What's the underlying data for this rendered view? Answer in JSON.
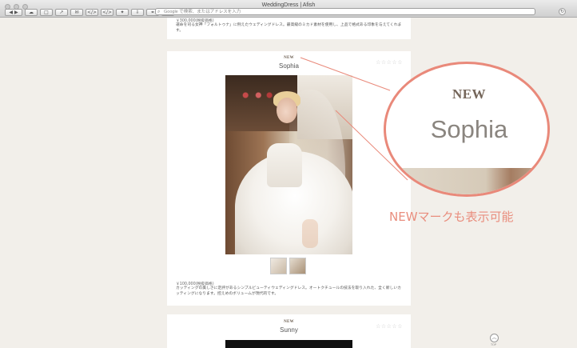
{
  "window": {
    "title": "WeddingDress | Afish"
  },
  "toolbar": {
    "buttons": [
      {
        "name": "back-forward-button",
        "glyph": "◀ ▶"
      },
      {
        "name": "sidebar-button",
        "glyph": "☁"
      },
      {
        "name": "bookmarks-button",
        "glyph": "□"
      },
      {
        "name": "share-button",
        "glyph": "↗"
      },
      {
        "name": "mail-button",
        "glyph": "✉"
      },
      {
        "name": "code-button",
        "glyph": "</>"
      },
      {
        "name": "code-button-2",
        "glyph": "</>"
      },
      {
        "name": "twitter-button",
        "glyph": "✦"
      },
      {
        "name": "download-button",
        "glyph": "⇩"
      },
      {
        "name": "link-button",
        "glyph": "⚭"
      },
      {
        "name": "new-tab-button",
        "glyph": "+"
      }
    ],
    "address_placeholder": "Google で検索、またはアドレスを入力"
  },
  "cards": {
    "top": {
      "price": "￥300,000(税抜価格)",
      "description": "運命を司る女神「フォルトゥナ」に例えたウェディングドレス。最高級のミカド素材を使用し、上品で格式ある印象を与えてくれます。"
    },
    "main": {
      "new_label": "NEW",
      "name": "Sophia",
      "rating": "☆☆☆☆☆",
      "price": "￥100,000(税抜価格)",
      "description": "カッティングの美しさに定評があるシンプルビューティウェディングドレス。オートクチュールの技法を取り入れた、全く新しいカッティングになります。控えめのボリュームが現代的です。"
    },
    "bottom": {
      "new_label": "NEW",
      "name": "Sunny",
      "rating": "☆☆☆☆☆"
    }
  },
  "callout": {
    "zoom_new": "NEW",
    "zoom_name": "Sophia",
    "caption": "NEWマークも表示可能",
    "accent_color": "#e9897a"
  },
  "scroll_top": {
    "glyph": "︿",
    "label": "TOP"
  }
}
